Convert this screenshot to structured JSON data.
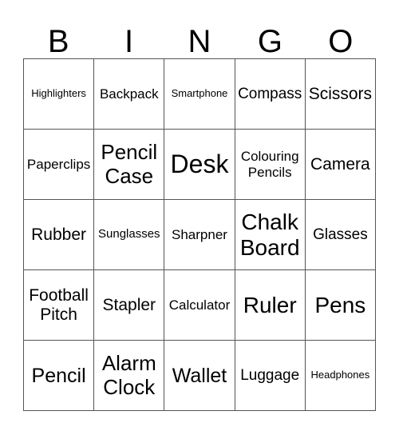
{
  "header": {
    "letters": [
      "B",
      "I",
      "N",
      "G",
      "O"
    ]
  },
  "board": {
    "rows": [
      [
        "Highlighters",
        "Backpack",
        "Smartphone",
        "Compass",
        "Scissors"
      ],
      [
        "Paperclips",
        "Pencil Case",
        "Desk",
        "Colouring Pencils",
        "Camera"
      ],
      [
        "Rubber",
        "Sunglasses",
        "Sharpner",
        "Chalk Board",
        "Glasses"
      ],
      [
        "Football Pitch",
        "Stapler",
        "Calculator",
        "Ruler",
        "Pens"
      ],
      [
        "Pencil",
        "Alarm Clock",
        "Wallet",
        "Luggage",
        "Headphones"
      ]
    ]
  },
  "colors": {
    "grid_line": "#555555",
    "text": "#000000",
    "background": "#ffffff"
  }
}
